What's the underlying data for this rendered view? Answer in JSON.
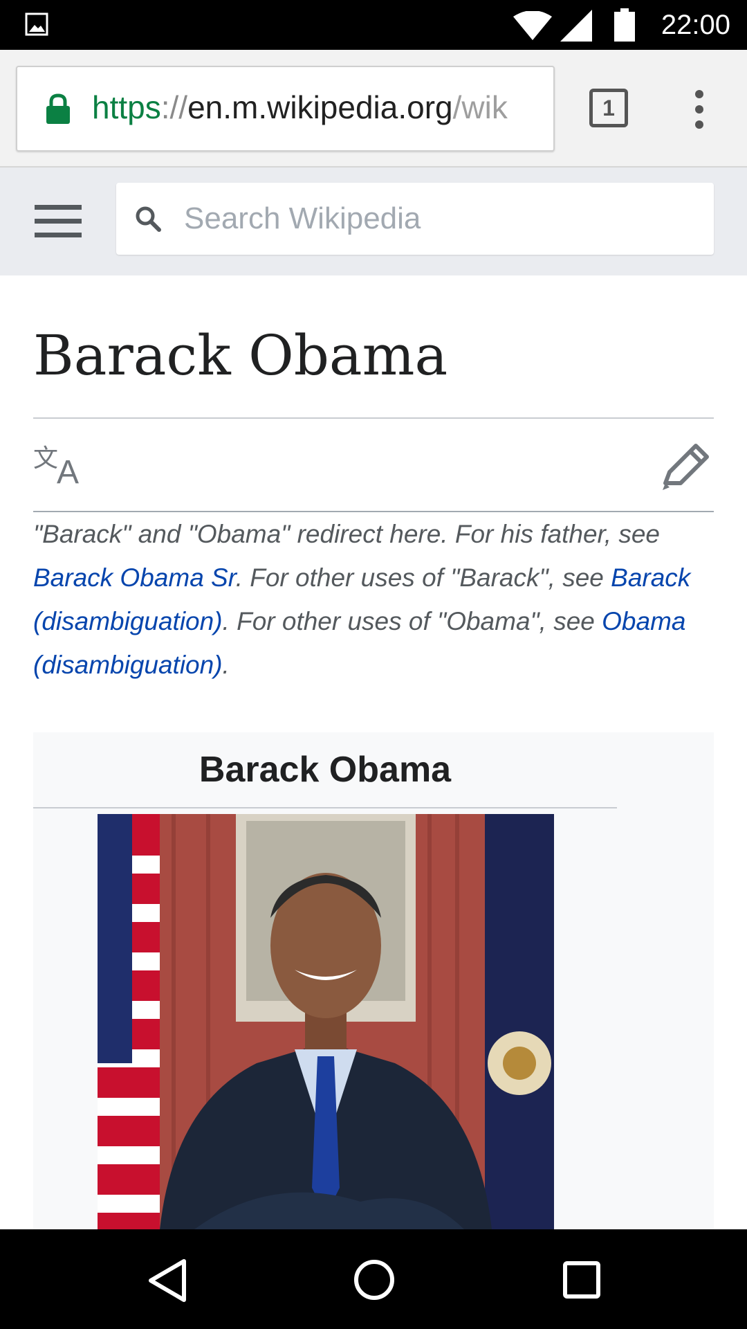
{
  "status_bar": {
    "time": "22:00",
    "icons": [
      "gallery-icon",
      "wifi-icon",
      "signal-icon",
      "battery-icon"
    ]
  },
  "browser": {
    "url": {
      "scheme": "https",
      "separator": "://",
      "host": "en.m.wikipedia.org",
      "path": "/wik"
    },
    "tab_count": "1",
    "icons": [
      "lock-icon",
      "tab-switcher-icon",
      "overflow-menu-icon"
    ],
    "colors": {
      "secure": "#0b8043"
    }
  },
  "wiki_header": {
    "search_placeholder": "Search Wikipedia",
    "icons": [
      "hamburger-menu-icon",
      "search-icon"
    ]
  },
  "article": {
    "title": "Barack Obama",
    "actions": [
      "language-icon",
      "edit-pencil-icon"
    ],
    "hatnote": {
      "t1": "\"Barack\" and \"Obama\" redirect here. For his father, see ",
      "link1": "Barack Obama Sr",
      "t2": ". For other uses of \"Barack\", see ",
      "link2": "Barack (disambiguation)",
      "t3": ". For other uses of \"Obama\", see ",
      "link3": "Obama (disambiguation)",
      "t4": "."
    },
    "infobox": {
      "title": "Barack Obama",
      "image": "portrait photo"
    },
    "colors": {
      "link": "#0645ad",
      "header_bg": "#eaecf0",
      "infobox_bg": "#f8f9fa"
    }
  },
  "nav_bar": {
    "icons": [
      "back-icon",
      "home-icon",
      "recents-icon"
    ]
  }
}
